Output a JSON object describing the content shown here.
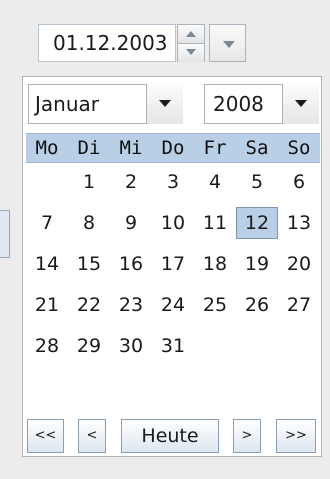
{
  "date_field": {
    "value": "01.12.2003"
  },
  "icons": {
    "spinner_up": "spin-up-icon",
    "spinner_down": "spin-down-icon",
    "popup_toggle": "chevron-down-icon"
  },
  "calendar": {
    "month": "Januar",
    "year": "2008",
    "weekdays": [
      "Mo",
      "Di",
      "Mi",
      "Do",
      "Fr",
      "Sa",
      "So"
    ],
    "weeks": [
      [
        "",
        "1",
        "2",
        "3",
        "4",
        "5",
        "6"
      ],
      [
        "7",
        "8",
        "9",
        "10",
        "11",
        "12",
        "13"
      ],
      [
        "14",
        "15",
        "16",
        "17",
        "18",
        "19",
        "20"
      ],
      [
        "21",
        "22",
        "23",
        "24",
        "25",
        "26",
        "27"
      ],
      [
        "28",
        "29",
        "30",
        "31",
        "",
        "",
        ""
      ]
    ],
    "selected_day": "12"
  },
  "nav": {
    "first": "<<",
    "prev": "<",
    "today": "Heute",
    "next": ">",
    "last": ">>"
  },
  "colors": {
    "header_bg": "#b8cfe5",
    "selected_bg": "#b8cfe5",
    "selected_border": "#7a97b4"
  }
}
